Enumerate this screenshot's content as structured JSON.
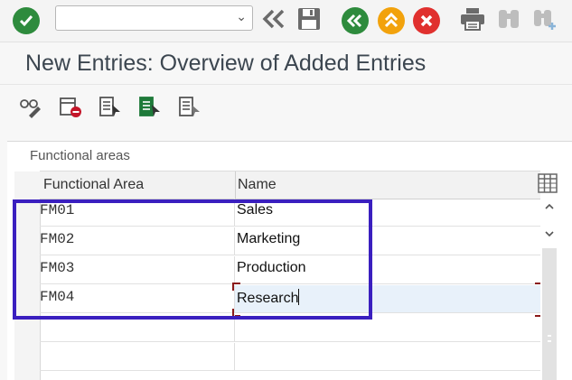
{
  "toolbar": {
    "command_field": {
      "value": "",
      "placeholder": ""
    },
    "icons": [
      "enter-icon",
      "collapse-icon",
      "save-icon",
      "back-icon",
      "exit-icon",
      "cancel-icon",
      "print-icon",
      "find-icon",
      "find-next-icon"
    ]
  },
  "title": "New Entries: Overview of Added Entries",
  "app_toolbar": {
    "icons": [
      "display-change-icon",
      "delete-icon",
      "select-all-icon",
      "select-block-icon",
      "deselect-all-icon"
    ]
  },
  "panel": {
    "title": "Functional areas",
    "columns": [
      "Functional Area",
      "Name"
    ],
    "rows": [
      {
        "code": "FM01",
        "name": "Sales"
      },
      {
        "code": "FM02",
        "name": "Marketing"
      },
      {
        "code": "FM03",
        "name": "Production"
      },
      {
        "code": "FM04",
        "name": "Research"
      }
    ]
  },
  "colors": {
    "green": "#2e8b3d",
    "amber": "#f2a20c",
    "red": "#e0302e",
    "highlight_box": "#3a1fbf",
    "active_cell": "#e8f1fa"
  }
}
